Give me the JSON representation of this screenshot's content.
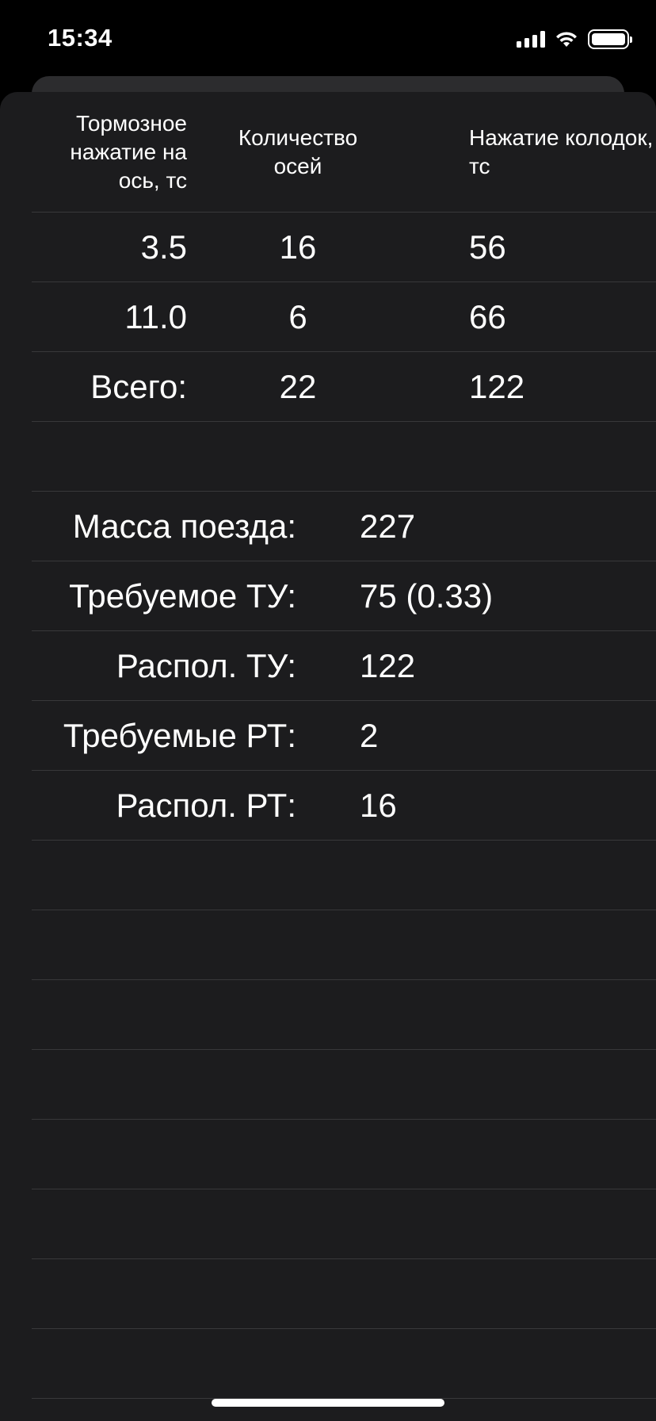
{
  "status_bar": {
    "time": "15:34"
  },
  "table": {
    "headers": [
      "Тормозное нажатие на ось, тс",
      "Количество осей",
      "Нажатие колодок, тс"
    ],
    "rows": [
      {
        "pressure_per_axle": "3.5",
        "axles": "16",
        "shoe_pressure": "56"
      },
      {
        "pressure_per_axle": "11.0",
        "axles": "6",
        "shoe_pressure": "66"
      }
    ],
    "total": {
      "label": "Всего:",
      "axles": "22",
      "shoe_pressure": "122"
    }
  },
  "summary": [
    {
      "label": "Масса поезда:",
      "value": "227"
    },
    {
      "label": "Требуемое ТУ:",
      "value": "75 (0.33)"
    },
    {
      "label": "Распол. ТУ:",
      "value": "122"
    },
    {
      "label": "Требуемые РТ:",
      "value": "2"
    },
    {
      "label": "Распол. РТ:",
      "value": "16"
    }
  ],
  "colors": {
    "background": "#000000",
    "sheet": "#1c1c1e",
    "separator": "#38383a",
    "text": "#ffffff"
  }
}
